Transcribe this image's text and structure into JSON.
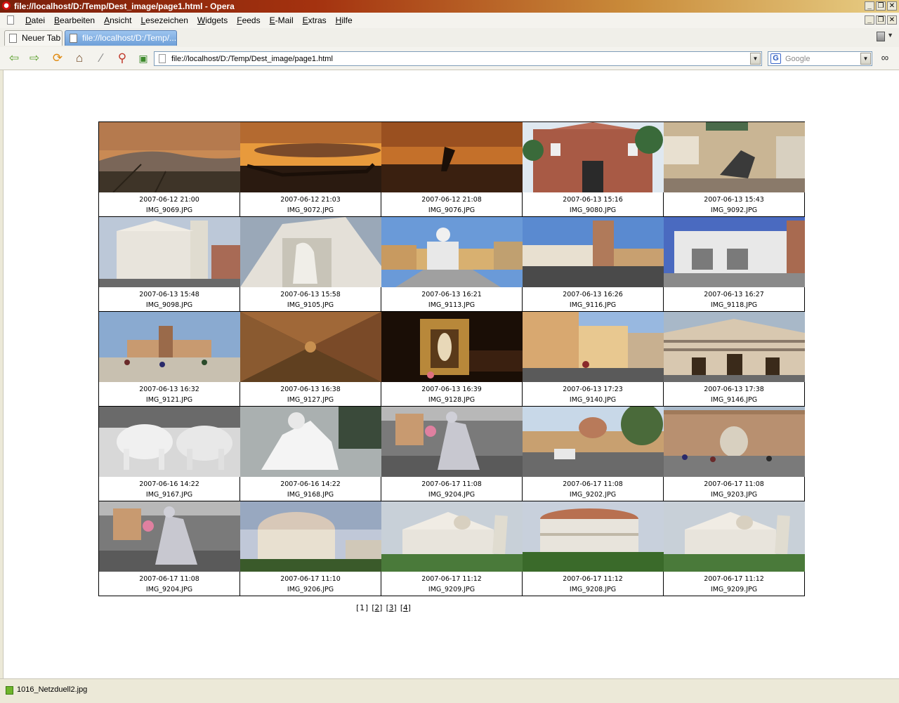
{
  "window": {
    "title": "file://localhost/D:/Temp/Dest_image/page1.html - Opera",
    "controls": [
      "_",
      "❐",
      "✕"
    ]
  },
  "menu": [
    "Datei",
    "Bearbeiten",
    "Ansicht",
    "Lesezeichen",
    "Widgets",
    "Feeds",
    "E-Mail",
    "Extras",
    "Hilfe"
  ],
  "tabs": [
    {
      "label": "Neuer Tab",
      "active": false
    },
    {
      "label": "file://localhost/D:/Temp/...",
      "active": true
    }
  ],
  "toolbar": {
    "icons": [
      "back-icon",
      "forward-icon",
      "reload-icon",
      "home-icon",
      "wand-icon",
      "search-icon",
      "bookmark-icon"
    ],
    "url": "file://localhost/D:/Temp/Dest_image/page1.html",
    "search_placeholder": "Google",
    "search_engine_glyph": "G"
  },
  "gallery": [
    {
      "date": "2007-06-12 21:00",
      "file": "IMG_9069.JPG",
      "scene": "sunset-hills"
    },
    {
      "date": "2007-06-12 21:03",
      "file": "IMG_9072.JPG",
      "scene": "sunset-boat"
    },
    {
      "date": "2007-06-12 21:08",
      "file": "IMG_9076.JPG",
      "scene": "sunset-figure"
    },
    {
      "date": "2007-06-13 15:16",
      "file": "IMG_9080.JPG",
      "scene": "brick-gate"
    },
    {
      "date": "2007-06-13 15:43",
      "file": "IMG_9092.JPG",
      "scene": "statue-building"
    },
    {
      "date": "2007-06-13 15:48",
      "file": "IMG_9098.JPG",
      "scene": "church-square"
    },
    {
      "date": "2007-06-13 15:58",
      "file": "IMG_9105.JPG",
      "scene": "white-facade"
    },
    {
      "date": "2007-06-13 16:21",
      "file": "IMG_9113.JPG",
      "scene": "monument-square"
    },
    {
      "date": "2007-06-13 16:26",
      "file": "IMG_9116.JPG",
      "scene": "tower-square"
    },
    {
      "date": "2007-06-13 16:27",
      "file": "IMG_9118.JPG",
      "scene": "cathedral-front"
    },
    {
      "date": "2007-06-13 16:32",
      "file": "IMG_9121.JPG",
      "scene": "piazza-crowd"
    },
    {
      "date": "2007-06-13 16:38",
      "file": "IMG_9127.JPG",
      "scene": "ceiling-fresco"
    },
    {
      "date": "2007-06-13 16:39",
      "file": "IMG_9128.JPG",
      "scene": "golden-shrine"
    },
    {
      "date": "2007-06-13 17:23",
      "file": "IMG_9140.JPG",
      "scene": "street-houses"
    },
    {
      "date": "2007-06-13 17:38",
      "file": "IMG_9146.JPG",
      "scene": "striped-church"
    },
    {
      "date": "2007-06-16 14:22",
      "file": "IMG_9167.JPG",
      "scene": "oxen-statues"
    },
    {
      "date": "2007-06-16 14:22",
      "file": "IMG_9168.JPG",
      "scene": "marble-sculpture"
    },
    {
      "date": "2007-06-17 11:08",
      "file": "IMG_9204.JPG",
      "scene": "silver-performer"
    },
    {
      "date": "2007-06-17 11:08",
      "file": "IMG_9202.JPG",
      "scene": "city-wall-street"
    },
    {
      "date": "2007-06-17 11:08",
      "file": "IMG_9203.JPG",
      "scene": "city-gate-crowd"
    },
    {
      "date": "2007-06-17 11:08",
      "file": "IMG_9204.JPG",
      "scene": "silver-performer"
    },
    {
      "date": "2007-06-17 11:10",
      "file": "IMG_9206.JPG",
      "scene": "baptistery"
    },
    {
      "date": "2007-06-17 11:12",
      "file": "IMG_9209.JPG",
      "scene": "duomo-tower"
    },
    {
      "date": "2007-06-17 11:12",
      "file": "IMG_9208.JPG",
      "scene": "baptistery-wide"
    },
    {
      "date": "2007-06-17 11:12",
      "file": "IMG_9209.JPG",
      "scene": "duomo-tower"
    }
  ],
  "pager": {
    "current": "1",
    "pages": [
      "2",
      "3",
      "4"
    ]
  },
  "status": {
    "text": "1016_Netzduell2.jpg"
  }
}
